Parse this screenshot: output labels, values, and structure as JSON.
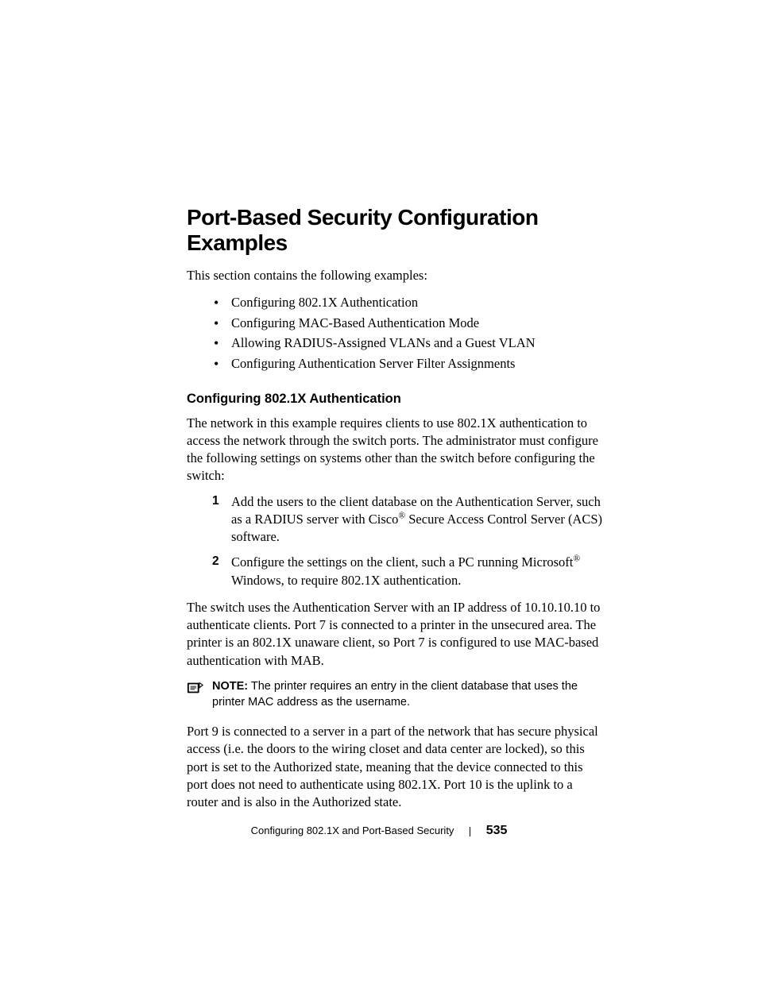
{
  "heading": "Port-Based Security Configuration Examples",
  "intro": "This section contains the following examples:",
  "bullets": [
    "Configuring 802.1X Authentication",
    "Configuring MAC-Based Authentication Mode",
    "Allowing RADIUS-Assigned VLANs and a Guest VLAN",
    "Configuring Authentication Server Filter Assignments"
  ],
  "subheading": "Configuring 802.1X Authentication",
  "para1": "The network in this example requires clients to use 802.1X authentication to access the network through the switch ports. The administrator must configure the following settings on systems other than the switch before configuring the switch:",
  "steps": {
    "s1_a": "Add the users to the client database on the Authentication Server, such as a RADIUS server with Cisco",
    "s1_b": " Secure Access Control Server (ACS) software.",
    "s2_a": "Configure the settings on the client, such a PC running Microsoft",
    "s2_b": " Windows, to require 802.1X authentication."
  },
  "para2": "The switch uses the Authentication Server with an IP address of 10.10.10.10 to authenticate clients. Port 7 is connected to a printer in the unsecured area. The printer is an 802.1X unaware client, so Port 7 is configured to use MAC-based authentication with MAB.",
  "note": {
    "label": "NOTE:",
    "text": " The printer requires an entry in the client database that uses the printer MAC address as the username."
  },
  "para3": "Port 9 is connected to a server in a part of the network that has secure physical access (i.e. the doors to the wiring closet and data center are locked), so this port is set to the Authorized state, meaning that the device connected to this port does not need to authenticate using 802.1X. Port 10 is the uplink to a router and is also in the Authorized state.",
  "footer": {
    "title": "Configuring 802.1X and Port-Based Security",
    "page": "535"
  },
  "registered": "®"
}
